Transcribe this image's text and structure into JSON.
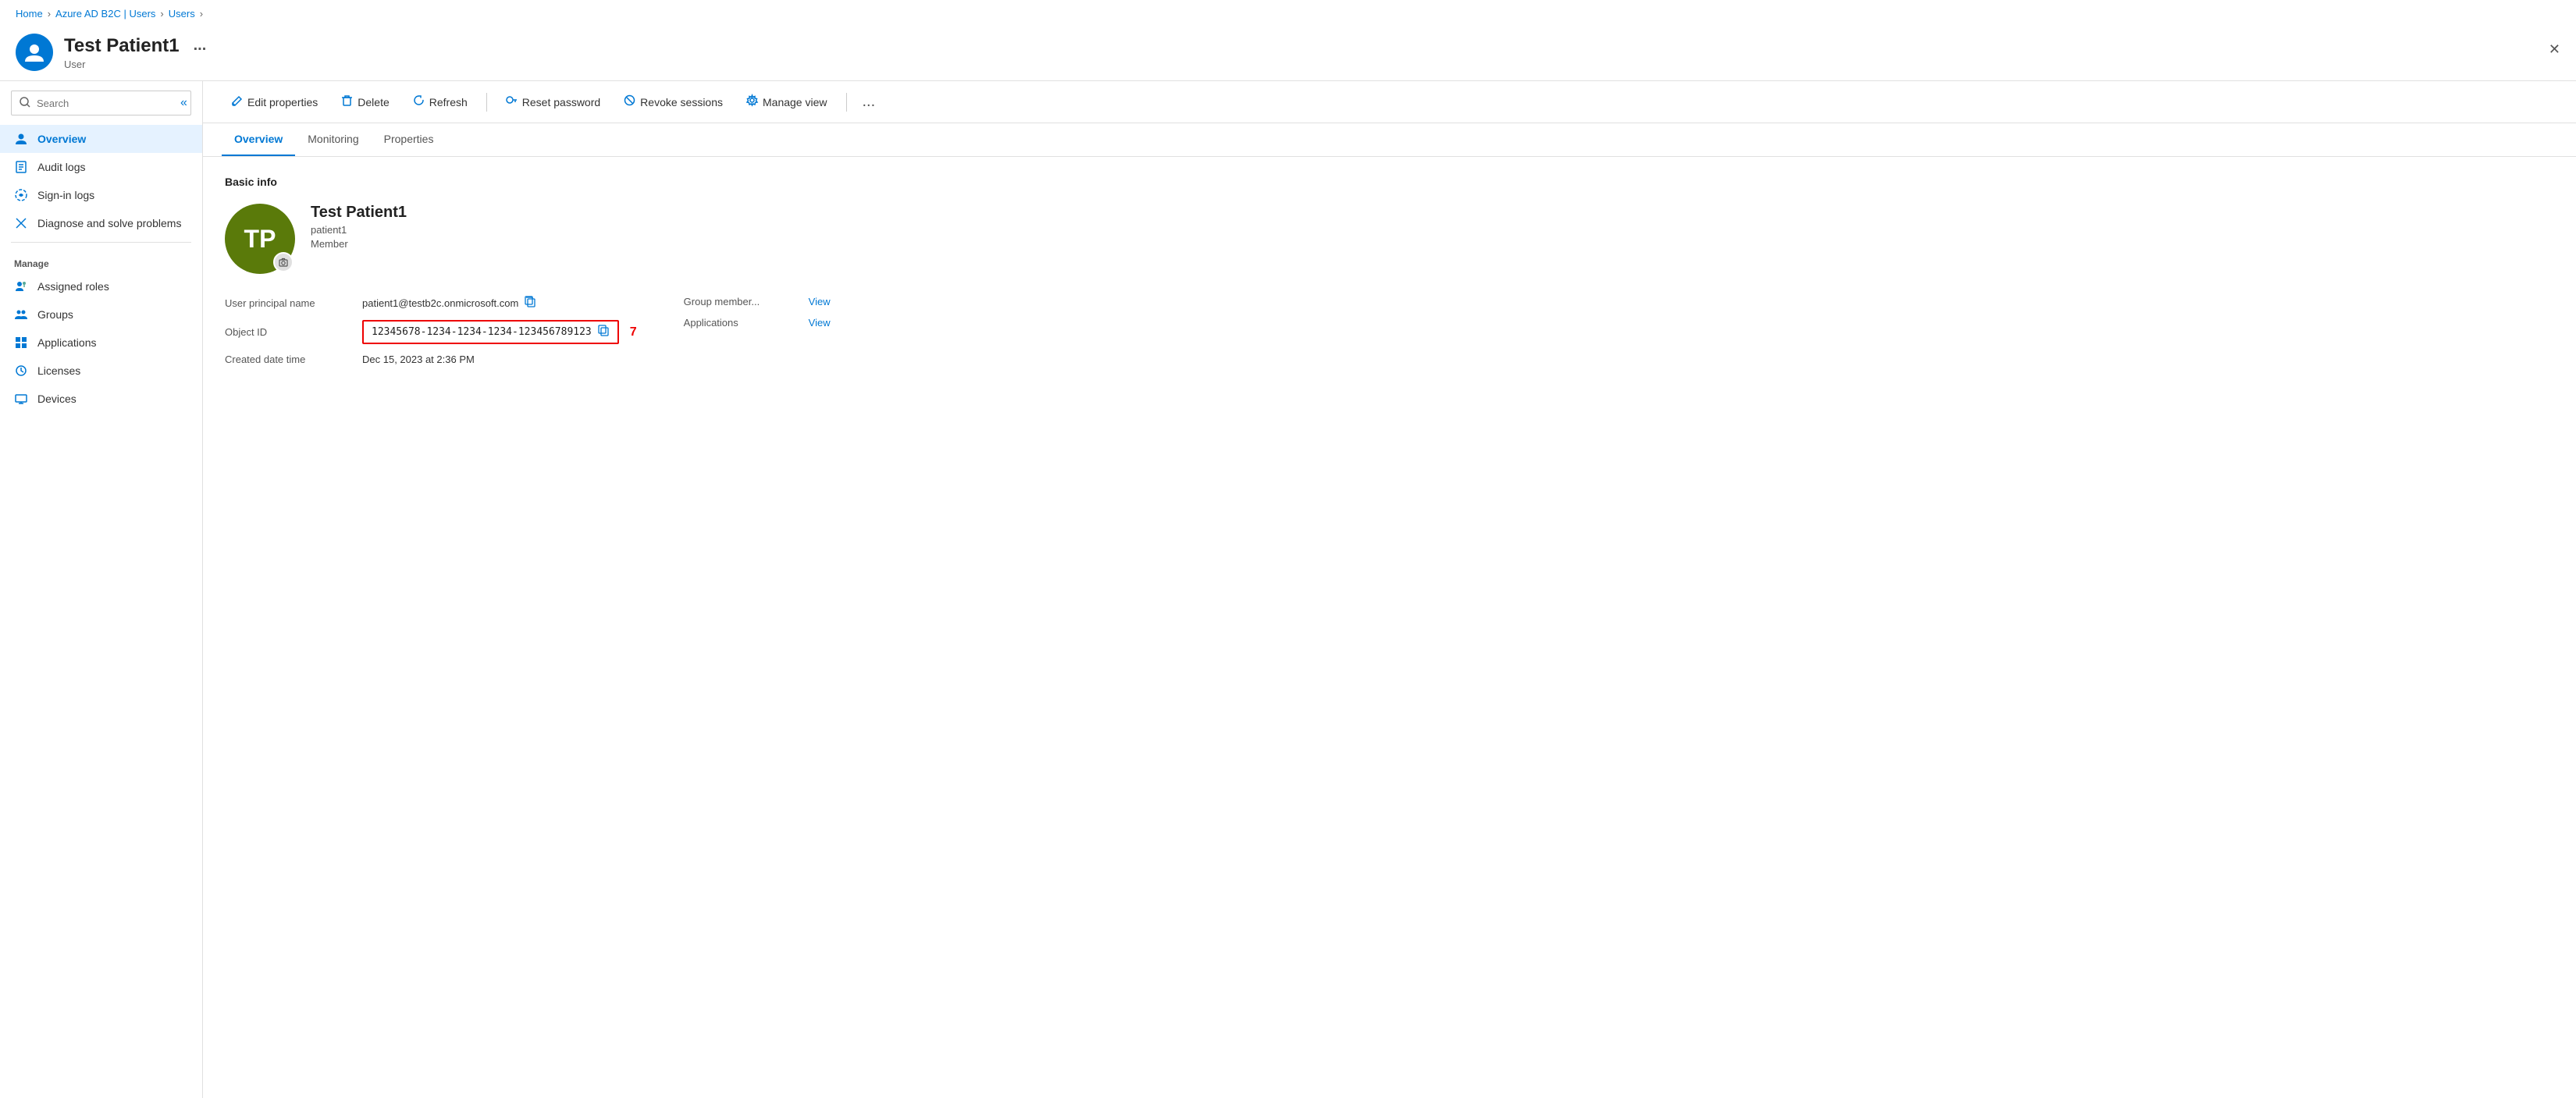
{
  "breadcrumb": {
    "items": [
      "Home",
      "Azure AD B2C | Users",
      "Users"
    ]
  },
  "header": {
    "title": "Test Patient1",
    "subtitle": "User",
    "avatar_initials": "🧑",
    "ellipsis": "..."
  },
  "search": {
    "placeholder": "Search"
  },
  "sidebar": {
    "items": [
      {
        "id": "overview",
        "label": "Overview",
        "icon": "user-icon",
        "active": true
      },
      {
        "id": "audit-logs",
        "label": "Audit logs",
        "icon": "audit-icon",
        "active": false
      },
      {
        "id": "sign-in-logs",
        "label": "Sign-in logs",
        "icon": "signin-icon",
        "active": false
      },
      {
        "id": "diagnose",
        "label": "Diagnose and solve problems",
        "icon": "diagnose-icon",
        "active": false
      }
    ],
    "manage_label": "Manage",
    "manage_items": [
      {
        "id": "assigned-roles",
        "label": "Assigned roles",
        "icon": "roles-icon"
      },
      {
        "id": "groups",
        "label": "Groups",
        "icon": "groups-icon"
      },
      {
        "id": "applications",
        "label": "Applications",
        "icon": "apps-icon"
      },
      {
        "id": "licenses",
        "label": "Licenses",
        "icon": "licenses-icon"
      },
      {
        "id": "devices",
        "label": "Devices",
        "icon": "devices-icon"
      }
    ]
  },
  "toolbar": {
    "buttons": [
      {
        "id": "edit-properties",
        "label": "Edit properties",
        "icon": "pencil-icon"
      },
      {
        "id": "delete",
        "label": "Delete",
        "icon": "trash-icon"
      },
      {
        "id": "refresh",
        "label": "Refresh",
        "icon": "refresh-icon"
      },
      {
        "id": "reset-password",
        "label": "Reset password",
        "icon": "key-icon"
      },
      {
        "id": "revoke-sessions",
        "label": "Revoke sessions",
        "icon": "ban-icon"
      },
      {
        "id": "manage-view",
        "label": "Manage view",
        "icon": "gear-icon"
      }
    ],
    "more": "..."
  },
  "tabs": {
    "items": [
      {
        "id": "overview",
        "label": "Overview",
        "active": true
      },
      {
        "id": "monitoring",
        "label": "Monitoring",
        "active": false
      },
      {
        "id": "properties",
        "label": "Properties",
        "active": false
      }
    ]
  },
  "overview": {
    "section_title": "Basic info",
    "user": {
      "avatar_initials": "TP",
      "display_name": "Test Patient1",
      "username": "patient1",
      "role": "Member"
    },
    "fields": [
      {
        "label": "User principal name",
        "value": "patient1@testb2c.onmicrosoft.com",
        "copyable": true,
        "highlighted": false
      },
      {
        "label": "Object ID",
        "value": "12345678-1234-1234-1234-123456789123",
        "copyable": true,
        "highlighted": true
      },
      {
        "label": "Created date time",
        "value": "Dec 15, 2023 at 2:36 PM",
        "copyable": false,
        "highlighted": false
      }
    ],
    "right_fields": [
      {
        "label": "Group member...",
        "link_text": "View"
      },
      {
        "label": "Applications",
        "link_text": "View"
      }
    ],
    "object_id_badge": "7"
  }
}
